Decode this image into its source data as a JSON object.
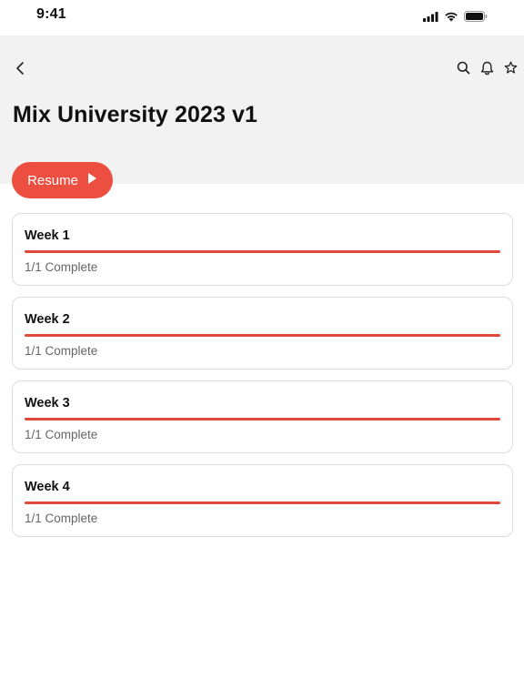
{
  "status_bar": {
    "time": "9:41"
  },
  "colors": {
    "accent": "#ec4e3f",
    "header_bg": "#f2f2f2",
    "card_border": "#dedede"
  },
  "nav": {
    "back_icon": "chevron-left-icon",
    "actions": [
      "search-icon",
      "bell-icon",
      "star-icon"
    ]
  },
  "page": {
    "title": "Mix University 2023 v1"
  },
  "resume": {
    "label": "Resume",
    "icon": "play-icon"
  },
  "weeks": [
    {
      "title": "Week 1",
      "status": "1/1 Complete",
      "progress": 1.0
    },
    {
      "title": "Week 2",
      "status": "1/1 Complete",
      "progress": 1.0
    },
    {
      "title": "Week 3",
      "status": "1/1 Complete",
      "progress": 1.0
    },
    {
      "title": "Week 4",
      "status": "1/1 Complete",
      "progress": 1.0
    }
  ]
}
